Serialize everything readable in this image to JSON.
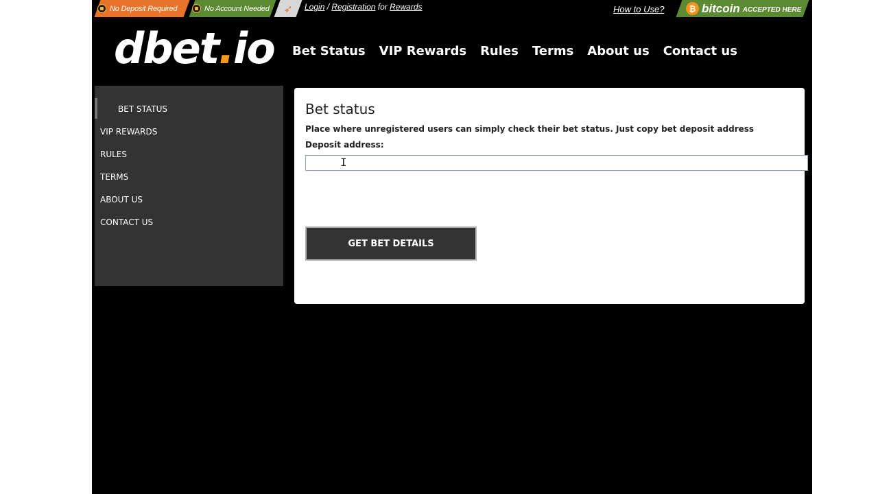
{
  "topbar": {
    "badge_no_deposit": "No Deposit Required",
    "badge_no_account": "No Account Needed",
    "login_label": "Login",
    "separator": "/",
    "registration_label": "Registration",
    "for_text": "for",
    "rewards_label": "Rewards",
    "how_to_use_label": "How to Use?",
    "bitcoin_word": "bitcoin",
    "bitcoin_accepted": "ACCEPTED HERE",
    "bitcoin_symbol": "₿",
    "twitter_icon": "twitter-bird-icon",
    "colors": {
      "orange": "#e8742a",
      "green": "#5c8a33",
      "bitcoin": "#f7931a"
    }
  },
  "header": {
    "logo_main": "dbet",
    "logo_dot": ".",
    "logo_tld": "io",
    "nav": [
      "Bet Status",
      "VIP Rewards",
      "Rules",
      "Terms",
      "About us",
      "Contact us"
    ]
  },
  "sidebar": {
    "items": [
      {
        "label": "BET STATUS",
        "active": true
      },
      {
        "label": "VIP REWARDS",
        "active": false
      },
      {
        "label": "RULES",
        "active": false
      },
      {
        "label": "TERMS",
        "active": false
      },
      {
        "label": "ABOUT US",
        "active": false
      },
      {
        "label": "CONTACT US",
        "active": false
      }
    ]
  },
  "main": {
    "title": "Bet status",
    "description": "Place where unregistered users can simply check their bet status. Just copy bet deposit address",
    "deposit_label": "Deposit address:",
    "deposit_value": "",
    "button_label": "GET BET DETAILS"
  }
}
